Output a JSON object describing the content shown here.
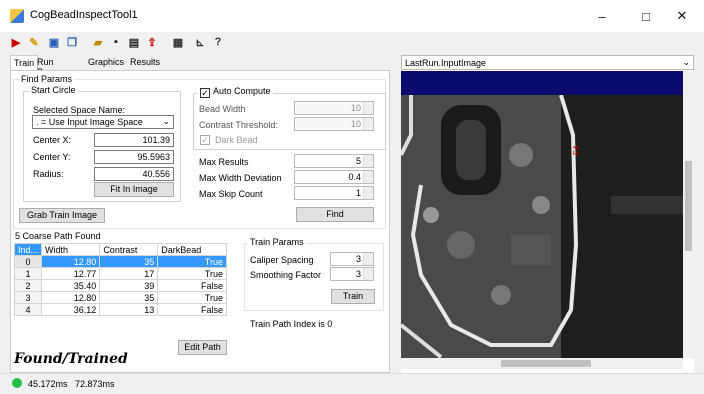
{
  "window": {
    "title": "CogBeadInspectTool1",
    "minimize": "–",
    "maximize": "□",
    "close": "✕"
  },
  "toolbar": {
    "icons": [
      "run-icon",
      "pen-icon",
      "display-icon",
      "copy-icon",
      "open-folder-icon",
      "save-icon",
      "settings-icon",
      "import-icon",
      "calculator-icon",
      "chart-icon",
      "help-icon"
    ]
  },
  "tabs": [
    "Train",
    "Run Params",
    "Graphics",
    "Results"
  ],
  "find_params": {
    "title": "Find Params",
    "start_circle": {
      "title": "Start Circle",
      "space_label": "Selected Space Name:",
      "space_value": ". = Use Input Image Space",
      "center_x_label": "Center X:",
      "center_x": "101.39",
      "center_y_label": "Center Y:",
      "center_y": "95.5963",
      "radius_label": "Radius:",
      "radius": "40.556",
      "fit_button": "Fit In Image"
    },
    "auto_compute": {
      "label": "Auto Compute",
      "checked": "✓",
      "bead_width_label": "Bead Width",
      "bead_width": "10",
      "contrast_label": "Contrast Threshold:",
      "contrast": "10",
      "dark_bead_label": "Dark Bead",
      "dark_bead_checked": "✓"
    },
    "max_results_label": "Max Results",
    "max_results": "5",
    "max_width_dev_label": "Max Width Deviation",
    "max_width_dev": "0.4",
    "max_skip_label": "Max Skip Count",
    "max_skip": "1",
    "grab_button": "Grab Train Image",
    "find_button": "Find"
  },
  "paths": {
    "caption": "5 Coarse Path Found",
    "headers": [
      "Ind...",
      "Width",
      "Contrast",
      "DarkBead"
    ],
    "rows": [
      [
        "0",
        "12.80",
        "35",
        "True"
      ],
      [
        "1",
        "12.77",
        "17",
        "True"
      ],
      [
        "2",
        "35.40",
        "39",
        "False"
      ],
      [
        "3",
        "12.80",
        "35",
        "True"
      ],
      [
        "4",
        "36.12",
        "13",
        "False"
      ]
    ],
    "edit_button": "Edit Path"
  },
  "train_params": {
    "title": "Train Params",
    "caliper_label": "Caliper Spacing",
    "caliper": "3",
    "smoothing_label": "Smoothing Factor",
    "smoothing": "3",
    "train_button": "Train",
    "path_index": "Train Path Index is 0"
  },
  "status_main": "Found/Trained",
  "status_bar": {
    "time1": "45.172ms",
    "time2": "72.873ms"
  },
  "image_panel": {
    "selector": "LastRun.InputImage",
    "marker": "F4"
  }
}
